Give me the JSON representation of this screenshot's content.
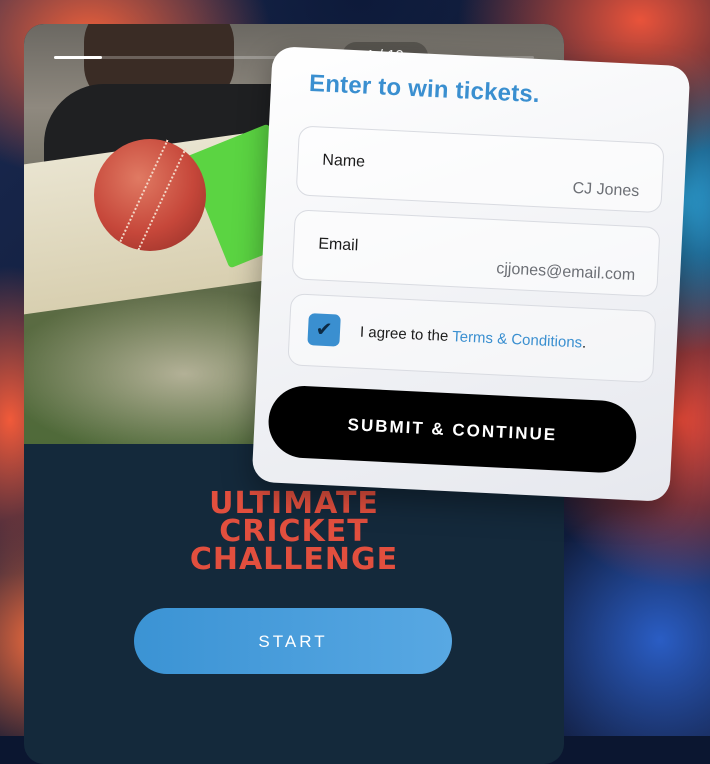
{
  "story": {
    "progress_current": 1,
    "progress_total": 10,
    "counter_text": "1 / 10",
    "title_line1": "ULTIMATE",
    "title_line2": "CRICKET",
    "title_line3": "CHALLENGE",
    "start_label": "START"
  },
  "form": {
    "heading": "Enter to win tickets.",
    "name_label": "Name",
    "name_value": "CJ Jones",
    "email_label": "Email",
    "email_value": "cjjones@email.com",
    "agree_prefix": "I agree to the ",
    "terms_link": "Terms & Conditions",
    "agree_suffix": ".",
    "checkbox_checked": true,
    "submit_label": "SUBMIT & CONTINUE"
  },
  "colors": {
    "accent_blue": "#3a8fd0",
    "title_red": "#e24f3e",
    "card_dark": "#14293b"
  },
  "icons": {
    "check": "checkmark-icon"
  }
}
